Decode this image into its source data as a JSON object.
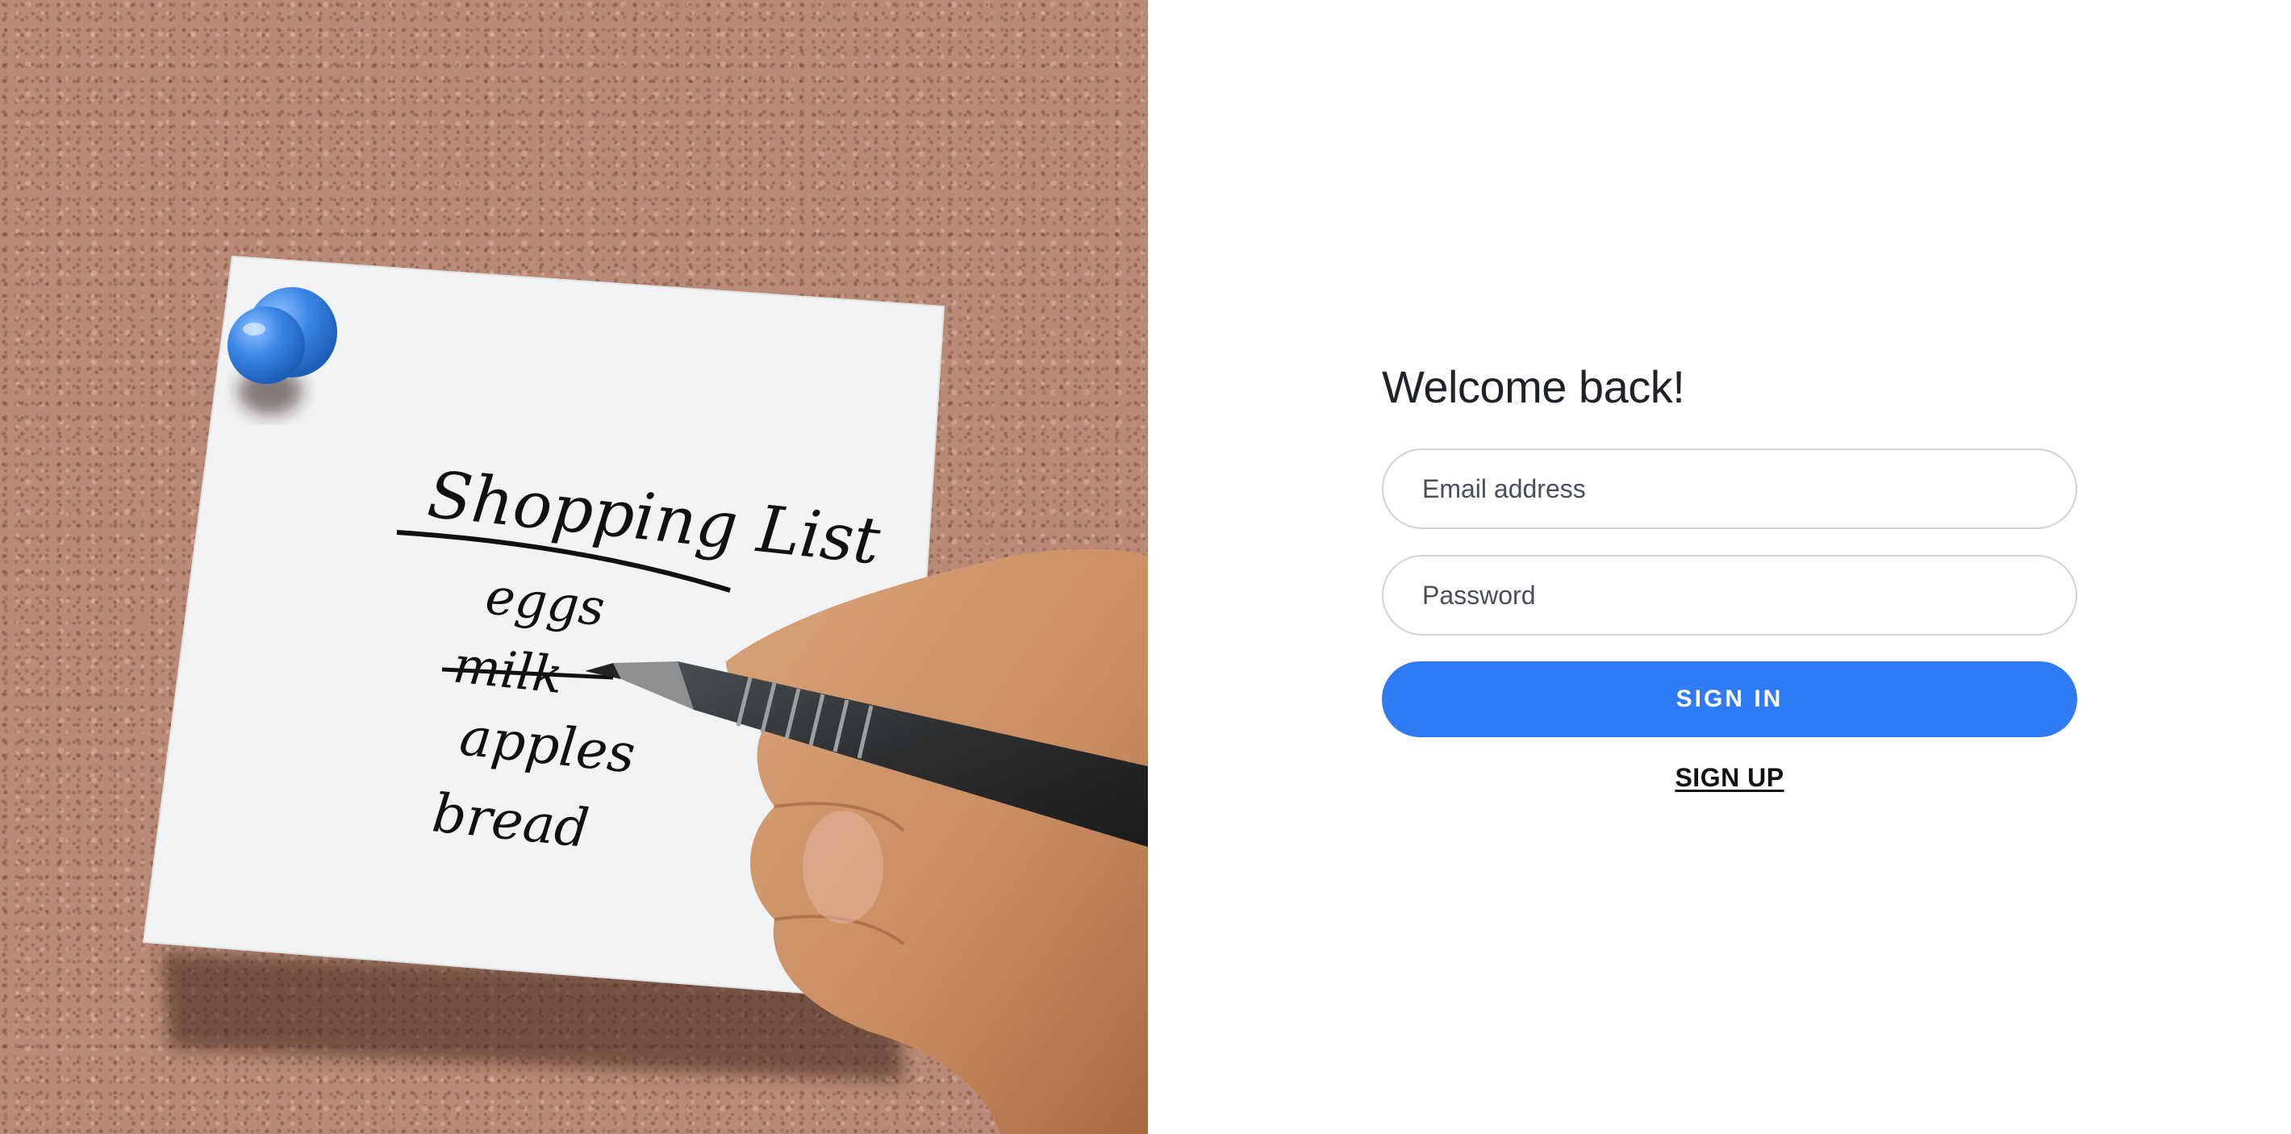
{
  "hero": {
    "image_alt": "Shopping list note pinned to cork board",
    "note_lines": [
      "Shopping List",
      "eggs",
      "milk",
      "apples",
      "bread"
    ]
  },
  "login": {
    "title": "Welcome back!",
    "email_placeholder": "Email address",
    "password_placeholder": "Password",
    "signin_label": "SIGN IN",
    "signup_label": "SIGN UP"
  },
  "colors": {
    "accent": "#2f7bf5",
    "pin": "#3a86e6",
    "cork": "#b98a76"
  }
}
